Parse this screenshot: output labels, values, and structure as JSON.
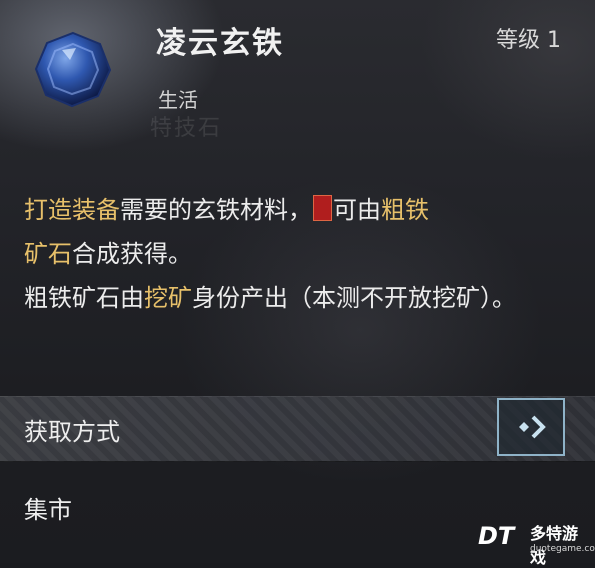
{
  "item": {
    "name": "凌云玄铁",
    "level": "等级 1",
    "category": "生活"
  },
  "description": {
    "p1": "打造装备",
    "p2": "需要的玄铁材料，",
    "p3": "可由",
    "p4": "粗铁",
    "p5": "矿石",
    "p6": "合成获得。",
    "p7": "粗铁矿石由",
    "p8": "挖矿",
    "p9": "身份产出（本测不开放挖矿）。"
  },
  "acquire": {
    "label": "获取方式"
  },
  "sources": {
    "market": "集市"
  },
  "brand": {
    "name": "多特游戏",
    "url": "duotegame.com",
    "logo": "DT"
  },
  "colors": {
    "highlight": "#e7c06a",
    "button_border": "#8fb3c8"
  },
  "icons": [
    "gem-icon",
    "arrow-right-icon",
    "badge-icon"
  ]
}
